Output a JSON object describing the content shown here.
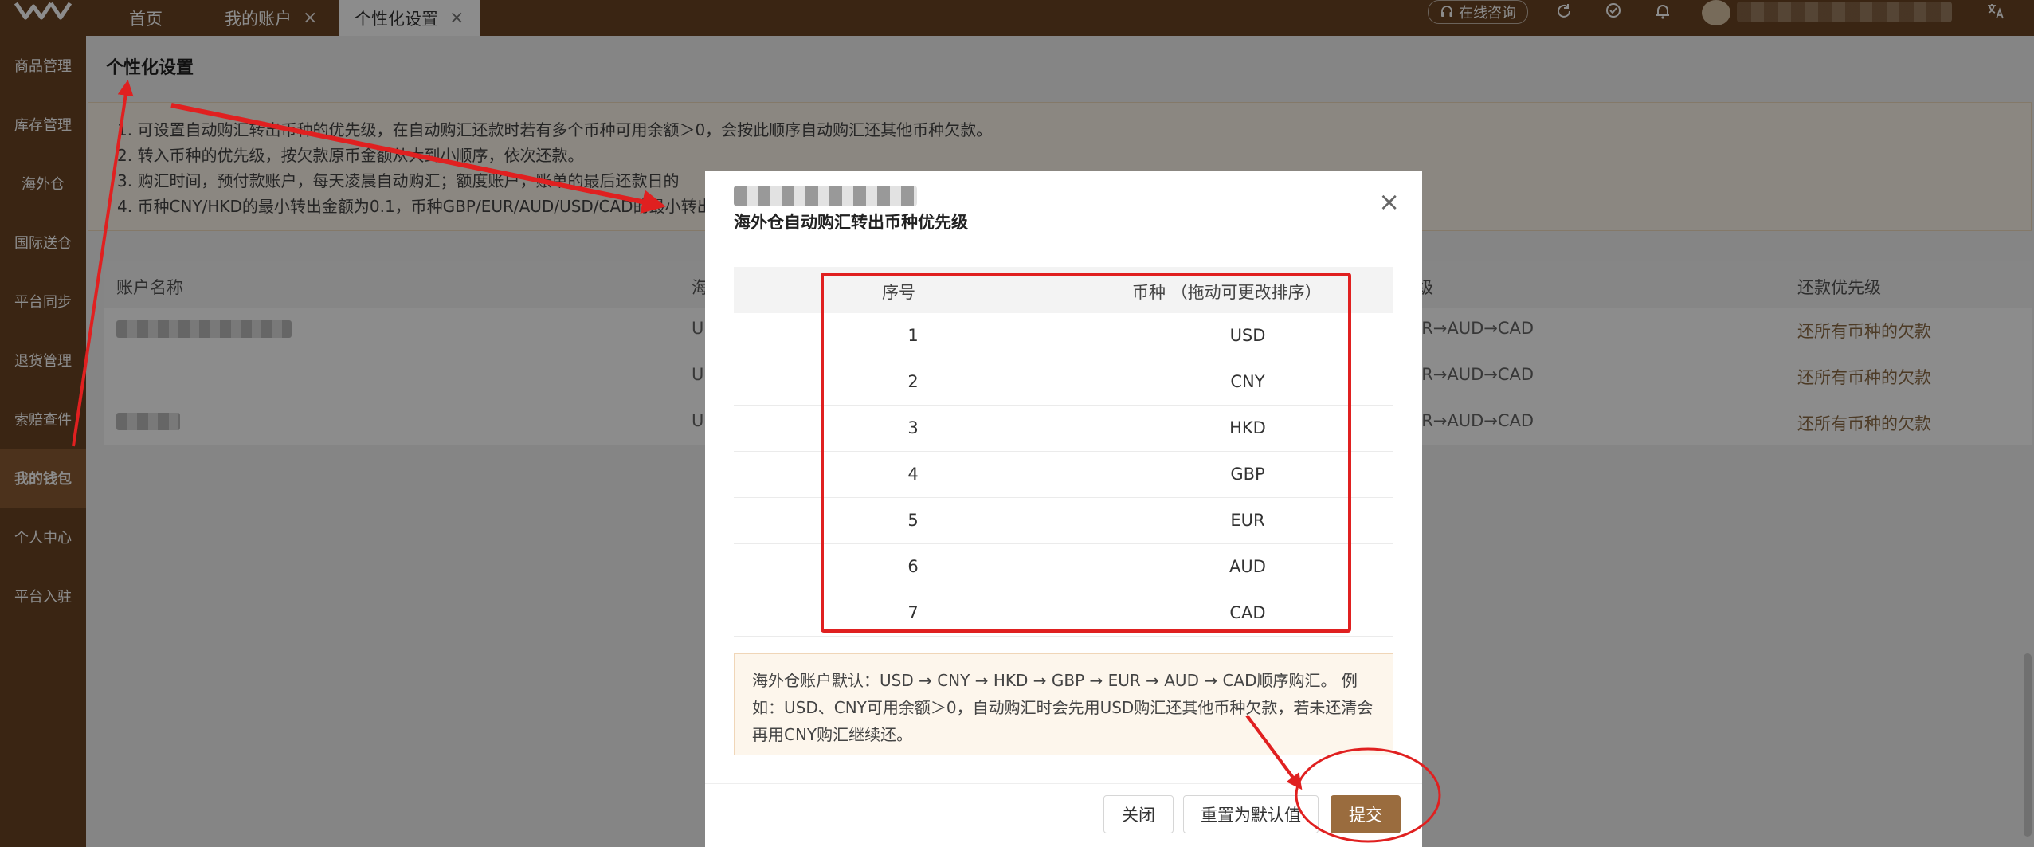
{
  "topbar": {
    "tabs": [
      {
        "label": "首页",
        "closable": false
      },
      {
        "label": "我的账户",
        "closable": true
      },
      {
        "label": "个性化设置",
        "closable": true,
        "active": true
      }
    ],
    "close_glyph": "×",
    "consult_label": "在线咨询",
    "icons": [
      "refresh-icon",
      "badge-icon",
      "bell-icon",
      "translate-icon"
    ]
  },
  "sidebar": {
    "items": [
      {
        "label": "商品管理"
      },
      {
        "label": "库存管理"
      },
      {
        "label": "海外仓"
      },
      {
        "label": "国际送仓"
      },
      {
        "label": "平台同步"
      },
      {
        "label": "退货管理"
      },
      {
        "label": "索赔查件"
      },
      {
        "label": "我的钱包",
        "active": true
      },
      {
        "label": "个人中心"
      },
      {
        "label": "平台入驻"
      }
    ]
  },
  "page": {
    "title": "个性化设置",
    "notice": [
      "1. 可设置自动购汇转出币种的优先级，在自动购汇还款时若有多个币种可用余额＞0，会按此顺序自动购汇还其他币种欠款。",
      "2. 转入币种的优先级，按欠款原币金额从大到小顺序，依次还款。",
      "3. 购汇时间，预付款账户，每天凌晨自动购汇；额度账户，账单的最后还款日的",
      "4. 币种CNY/HKD的最小转出金额为0.1，币种GBP/EUR/AUD/USD/CAD的最小转出"
    ],
    "table": {
      "headers": [
        "账户名称",
        "海",
        "级",
        "还款优先级"
      ],
      "rows": [
        {
          "col2": "U",
          "col3": "JR→AUD→CAD",
          "col4": "还所有币种的欠款"
        },
        {
          "col2": "U",
          "col3": "JR→AUD→CAD",
          "col4": "还所有币种的欠款"
        },
        {
          "col2": "U",
          "col3": "JR→AUD→CAD",
          "col4": "还所有币种的欠款"
        }
      ]
    }
  },
  "modal": {
    "title": "海外仓自动购汇转出币种优先级",
    "close_glyph": "×",
    "headers": {
      "index": "序号",
      "currency": "币种 （拖动可更改排序）"
    },
    "rows": [
      {
        "index": "1",
        "currency": "USD"
      },
      {
        "index": "2",
        "currency": "CNY"
      },
      {
        "index": "3",
        "currency": "HKD"
      },
      {
        "index": "4",
        "currency": "GBP"
      },
      {
        "index": "5",
        "currency": "EUR"
      },
      {
        "index": "6",
        "currency": "AUD"
      },
      {
        "index": "7",
        "currency": "CAD"
      }
    ],
    "tip": "海外仓账户默认：USD → CNY → HKD → GBP → EUR → AUD → CAD顺序购汇。 例如：USD、CNY可用余额＞0，自动购汇时会先用USD购汇还其他币种欠款，若未还清会再用CNY购汇继续还。",
    "buttons": {
      "close": "关闭",
      "reset": "重置为默认值",
      "submit": "提交"
    }
  },
  "colors": {
    "brand": "#6b4423",
    "accent": "#9a6c3e",
    "annotation": "#e02020"
  }
}
